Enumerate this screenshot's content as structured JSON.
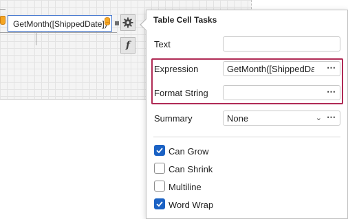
{
  "designer": {
    "cell_text": "GetMonth([ShippedDate])"
  },
  "panel": {
    "title": "Table Cell Tasks",
    "text": {
      "label": "Text",
      "value": ""
    },
    "expression": {
      "label": "Expression",
      "value": "GetMonth([ShippedDate])"
    },
    "format_string": {
      "label": "Format String",
      "value": ""
    },
    "summary": {
      "label": "Summary",
      "value": "None"
    },
    "checkboxes": [
      {
        "label": "Can Grow",
        "checked": true
      },
      {
        "label": "Can Shrink",
        "checked": false
      },
      {
        "label": "Multiline",
        "checked": false
      },
      {
        "label": "Word Wrap",
        "checked": true
      }
    ]
  },
  "colors": {
    "accent": "#1b62c4",
    "highlight_border": "#b02a55",
    "cell_border": "#4a7bd0"
  }
}
